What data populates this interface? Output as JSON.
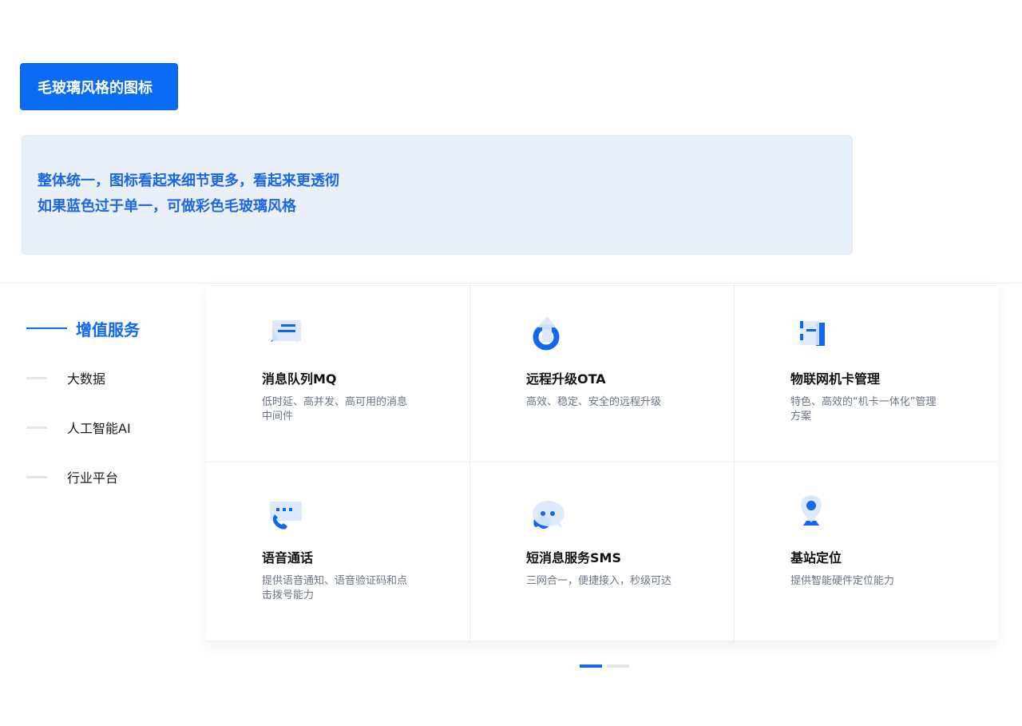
{
  "header": {
    "title": "毛玻璃风格的图标"
  },
  "note": {
    "line1": "整体统一，图标看起来细节更多，看起来更透彻",
    "line2": "如果蓝色过于单一，可做彩色毛玻璃风格"
  },
  "sidebar": {
    "items": [
      {
        "label": "增值服务",
        "active": true
      },
      {
        "label": "大数据"
      },
      {
        "label": "人工智能AI"
      },
      {
        "label": "行业平台"
      }
    ]
  },
  "services": [
    {
      "title": "消息队列MQ",
      "desc": "低时延、高并发、高可用的消息中间件",
      "icon": "message-queue-icon"
    },
    {
      "title": "远程升级OTA",
      "desc": "高效、稳定、安全的远程升级",
      "icon": "ota-upgrade-icon"
    },
    {
      "title": "物联网机卡管理",
      "desc": "特色、高效的“机卡一体化”管理方案",
      "icon": "sim-card-icon"
    },
    {
      "title": "语音通话",
      "desc": "提供语音通知、语音验证码和点击拨号能力",
      "icon": "phone-call-icon"
    },
    {
      "title": "短消息服务SMS",
      "desc": "三网合一，便捷接入，秒级可达",
      "icon": "chat-bubble-icon"
    },
    {
      "title": "基站定位",
      "desc": "提供智能硬件定位能力",
      "icon": "location-pin-icon"
    }
  ],
  "pager": {
    "pages": 2,
    "current": 1
  },
  "colors": {
    "primary": "#0a6cf5",
    "note_bg": "#eaf0f9",
    "icon_light": "#dbe8fb"
  }
}
